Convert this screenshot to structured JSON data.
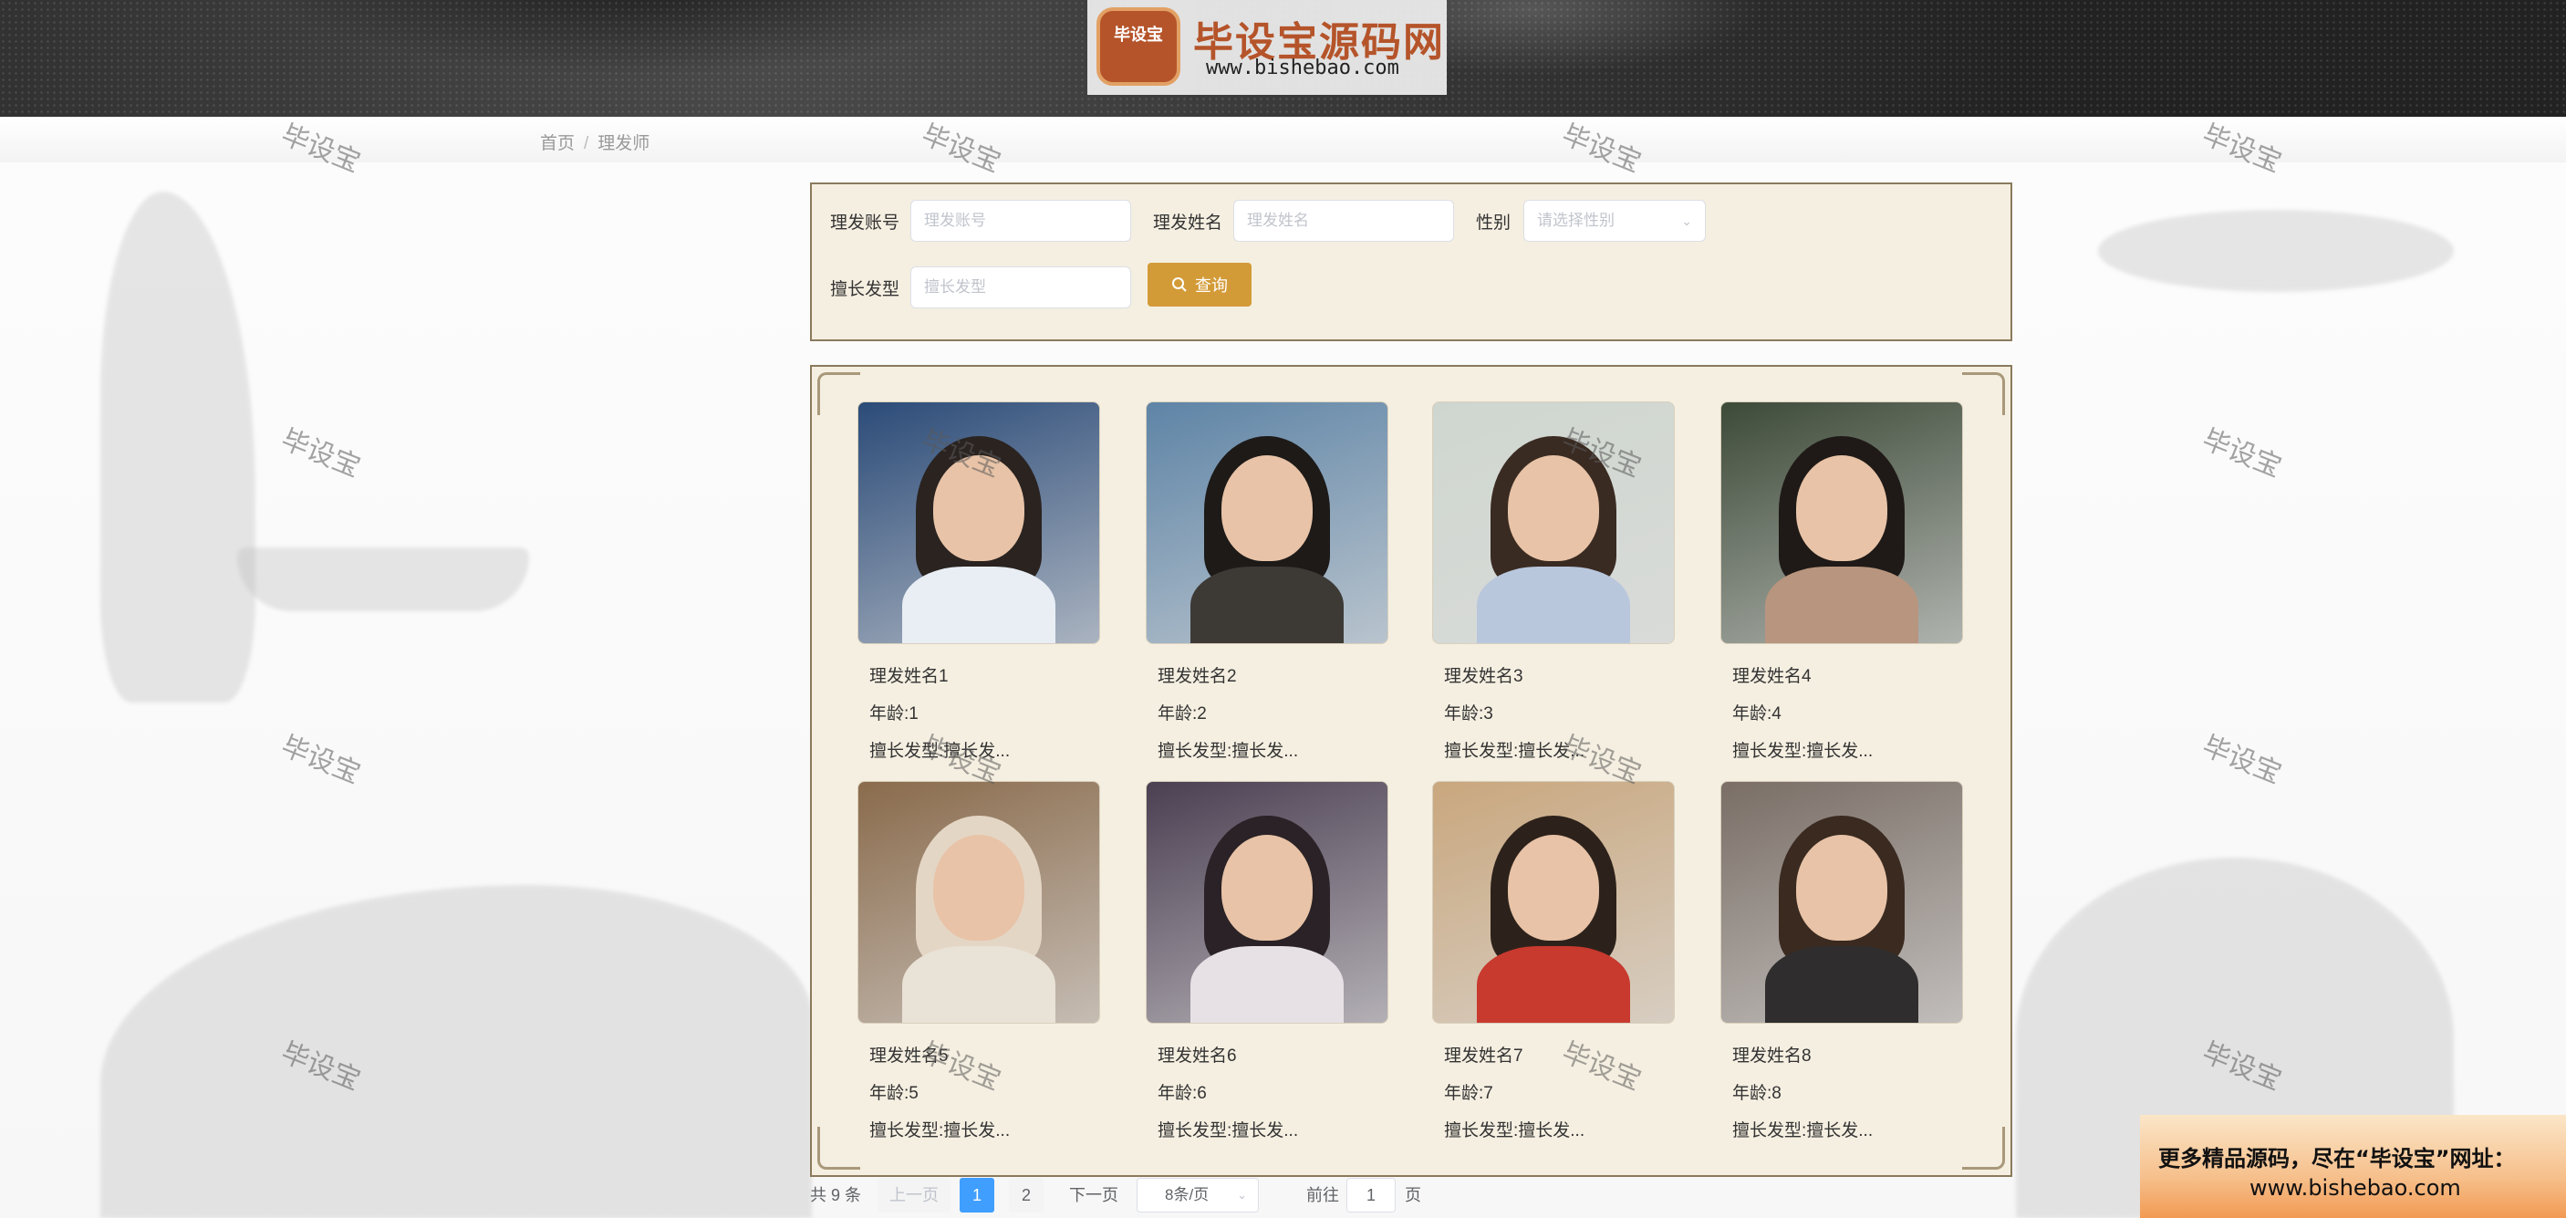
{
  "header": {
    "logo_badge": "毕设宝",
    "logo_title": "毕设宝源码网",
    "logo_url": "www.bishebao.com"
  },
  "breadcrumb": {
    "home": "首页",
    "separator": "/",
    "current": "理发师"
  },
  "search": {
    "account_label": "理发账号",
    "account_placeholder": "理发账号",
    "name_label": "理发姓名",
    "name_placeholder": "理发姓名",
    "gender_label": "性别",
    "gender_placeholder": "请选择性别",
    "style_label": "擅长发型",
    "style_placeholder": "擅长发型",
    "search_button": "查询"
  },
  "barbers": [
    {
      "name": "理发姓名1",
      "age": "年龄:1",
      "style": "擅长发型:擅长发...",
      "palette": {
        "bg": "#2b4b78",
        "hair": "#2a2320",
        "shirt": "#e9eef5"
      }
    },
    {
      "name": "理发姓名2",
      "age": "年龄:2",
      "style": "擅长发型:擅长发...",
      "palette": {
        "bg": "#5e84a6",
        "hair": "#1d1a18",
        "shirt": "#3d3a36"
      }
    },
    {
      "name": "理发姓名3",
      "age": "年龄:3",
      "style": "擅长发型:擅长发...",
      "palette": {
        "bg": "#cfd6cf",
        "hair": "#3a2b22",
        "shirt": "#b9c7dd"
      }
    },
    {
      "name": "理发姓名4",
      "age": "年龄:4",
      "style": "擅长发型:擅长发...",
      "palette": {
        "bg": "#3d4a38",
        "hair": "#1f1a17",
        "shirt": "#b8957e"
      }
    },
    {
      "name": "理发姓名5",
      "age": "年龄:5",
      "style": "擅长发型:擅长发...",
      "palette": {
        "bg": "#8a6b4c",
        "hair": "#e4d6c5",
        "shirt": "#e9e2d6"
      }
    },
    {
      "name": "理发姓名6",
      "age": "年龄:6",
      "style": "擅长发型:擅长发...",
      "palette": {
        "bg": "#4b3f52",
        "hair": "#2a2226",
        "shirt": "#e7e1e6"
      }
    },
    {
      "name": "理发姓名7",
      "age": "年龄:7",
      "style": "擅长发型:擅长发...",
      "palette": {
        "bg": "#c9a77e",
        "hair": "#2d221b",
        "shirt": "#c8392e"
      }
    },
    {
      "name": "理发姓名8",
      "age": "年龄:8",
      "style": "擅长发型:擅长发...",
      "palette": {
        "bg": "#7a6e66",
        "hair": "#3a2a20",
        "shirt": "#2f2d2e"
      }
    }
  ],
  "pagination": {
    "total": "共 9 条",
    "prev": "上一页",
    "pages": [
      "1",
      "2"
    ],
    "active_page": "1",
    "next": "下一页",
    "page_size": "8条/页",
    "goto_label": "前往",
    "goto_value": "1",
    "goto_unit": "页"
  },
  "watermark": "毕设宝",
  "promo": {
    "line1": "更多精品源码，尽在“毕设宝”网址：",
    "line2": "www.bishebao.com"
  },
  "colors": {
    "accent": "#d39b38",
    "panel": "#f5efe1",
    "active_page": "#409eff"
  }
}
